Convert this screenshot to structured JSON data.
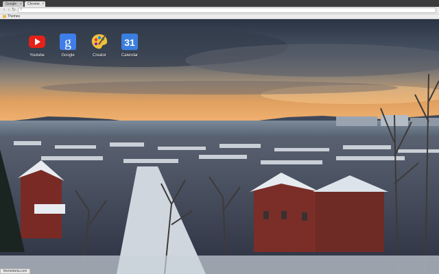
{
  "browser": {
    "tabs": [
      {
        "label": "Google",
        "active": false
      },
      {
        "label": "Chrome",
        "active": true
      }
    ],
    "omnibox_value": "",
    "bookmarks": [
      {
        "label": "Themes"
      }
    ]
  },
  "apps": [
    {
      "label": "Youtube",
      "icon": "youtube-icon",
      "color": "#e62117"
    },
    {
      "label": "Google",
      "icon": "google-icon",
      "color": "#3f7ee8"
    },
    {
      "label": "Creator",
      "icon": "palette-icon",
      "color": "#f0c23a"
    },
    {
      "label": "Calendar",
      "icon": "calendar-icon",
      "color": "#3a7ee0",
      "day": "31"
    }
  ],
  "status_bar": {
    "text": "themebeta.com"
  }
}
